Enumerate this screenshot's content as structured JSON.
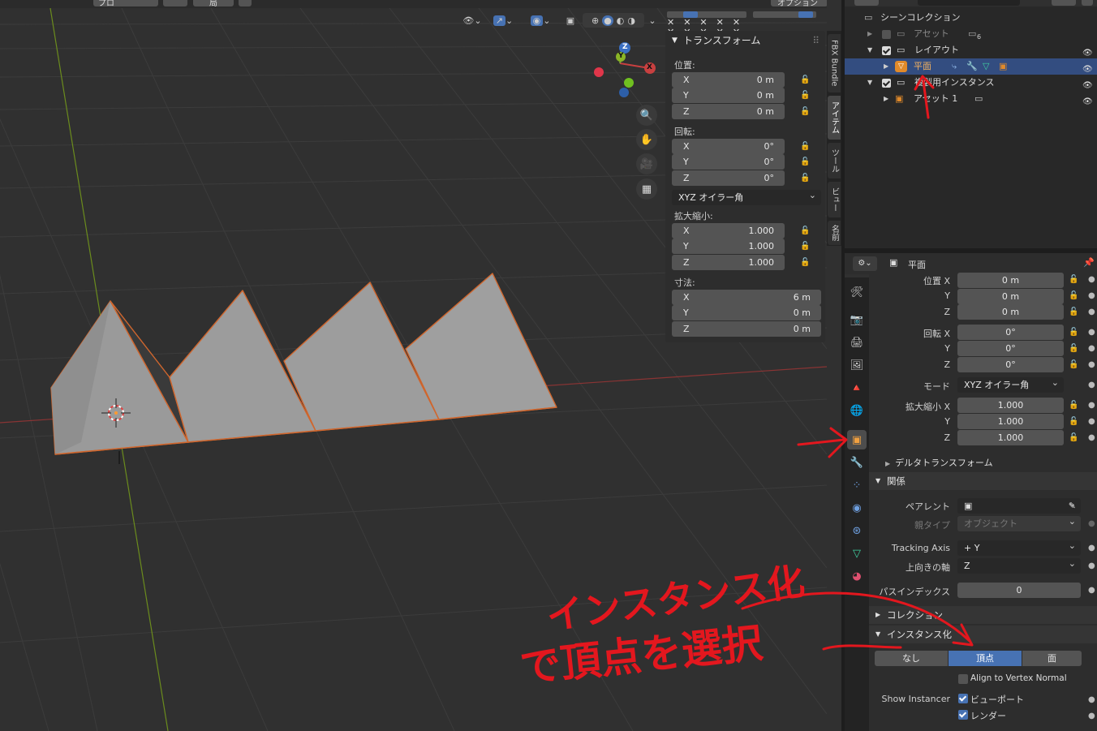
{
  "viewport": {
    "header_partial_1": "プロ",
    "header_partial_2": "局",
    "header_partial_3": "オプション",
    "gizmo": {
      "x": "X",
      "y": "Y",
      "z": "Z"
    }
  },
  "npanel": {
    "title": "トランスフォーム",
    "location_label": "位置:",
    "rotation_label": "回転:",
    "scale_label": "拡大縮小:",
    "dimensions_label": "寸法:",
    "location": [
      {
        "k": "X",
        "v": "0 m"
      },
      {
        "k": "Y",
        "v": "0 m"
      },
      {
        "k": "Z",
        "v": "0 m"
      }
    ],
    "rotation": [
      {
        "k": "X",
        "v": "0°"
      },
      {
        "k": "Y",
        "v": "0°"
      },
      {
        "k": "Z",
        "v": "0°"
      }
    ],
    "rotation_mode": "XYZ オイラー角",
    "scale": [
      {
        "k": "X",
        "v": "1.000"
      },
      {
        "k": "Y",
        "v": "1.000"
      },
      {
        "k": "Z",
        "v": "1.000"
      }
    ],
    "dimensions": [
      {
        "k": "X",
        "v": "6 m"
      },
      {
        "k": "Y",
        "v": "0 m"
      },
      {
        "k": "Z",
        "v": "0 m"
      }
    ]
  },
  "side_tabs": [
    "FBX Bundle",
    "アイテム",
    "ツール",
    "ビュー",
    "名前"
  ],
  "outliner": {
    "scene_collection": "シーンコレクション",
    "asset": "アセット",
    "asset_count": "6",
    "layout": "レイアウト",
    "plane": "平面",
    "dup_instance": "複製用インスタンス",
    "asset1": "アセット 1"
  },
  "properties": {
    "object_name": "平面",
    "loc_x": "位置 X",
    "y": "Y",
    "z": "Z",
    "loc_values": [
      "0 m",
      "0 m",
      "0 m"
    ],
    "rot_x": "回転 X",
    "rot_values": [
      "0°",
      "0°",
      "0°"
    ],
    "mode_label": "モード",
    "mode_value": "XYZ オイラー角",
    "scale_x": "拡大縮小 X",
    "scale_values": [
      "1.000",
      "1.000",
      "1.000"
    ],
    "delta_transform": "デルタトランスフォーム",
    "relations": "関係",
    "parent_label": "ペアレント",
    "parent_type_label": "親タイプ",
    "parent_type_value": "オブジェクト",
    "tracking_axis_label": "Tracking Axis",
    "tracking_axis_value": "+ Y",
    "up_axis_label": "上向きの軸",
    "up_axis_value": "Z",
    "pass_index_label": "パスインデックス",
    "pass_index_value": "0",
    "collection": "コレクション",
    "instancing": "インスタンス化",
    "inst_none": "なし",
    "inst_vertices": "頂点",
    "inst_faces": "面",
    "align_vertex_normal": "Align to Vertex Normal",
    "show_instancer_label": "Show Instancer",
    "viewport_cb": "ビューポート",
    "render_cb": "レンダー"
  },
  "annotation": {
    "line1": "インスタンス化",
    "line2": "で頂点を選択",
    "color": "#e3171e"
  },
  "colors": {
    "selection": "#334d80",
    "active_button": "#4772b3",
    "x_axis": "#a83a3a",
    "y_axis": "#7a9b1f",
    "object_outline": "#d0662d"
  }
}
